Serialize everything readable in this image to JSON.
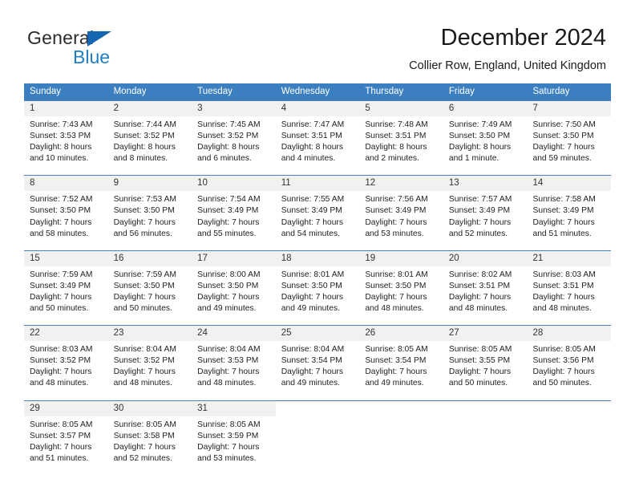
{
  "brand": {
    "name_part1": "General",
    "name_part2": "Blue",
    "accent_color": "#1f7ec4",
    "triangle_color": "#1565b0"
  },
  "header": {
    "title": "December 2024",
    "subtitle": "Collier Row, England, United Kingdom"
  },
  "calendar": {
    "header_bg": "#3c7fc1",
    "daynum_bg": "#f1f1f1",
    "weekdays": [
      "Sunday",
      "Monday",
      "Tuesday",
      "Wednesday",
      "Thursday",
      "Friday",
      "Saturday"
    ],
    "weeks": [
      [
        {
          "day": "1",
          "sunrise": "Sunrise: 7:43 AM",
          "sunset": "Sunset: 3:53 PM",
          "daylight": "Daylight: 8 hours and 10 minutes."
        },
        {
          "day": "2",
          "sunrise": "Sunrise: 7:44 AM",
          "sunset": "Sunset: 3:52 PM",
          "daylight": "Daylight: 8 hours and 8 minutes."
        },
        {
          "day": "3",
          "sunrise": "Sunrise: 7:45 AM",
          "sunset": "Sunset: 3:52 PM",
          "daylight": "Daylight: 8 hours and 6 minutes."
        },
        {
          "day": "4",
          "sunrise": "Sunrise: 7:47 AM",
          "sunset": "Sunset: 3:51 PM",
          "daylight": "Daylight: 8 hours and 4 minutes."
        },
        {
          "day": "5",
          "sunrise": "Sunrise: 7:48 AM",
          "sunset": "Sunset: 3:51 PM",
          "daylight": "Daylight: 8 hours and 2 minutes."
        },
        {
          "day": "6",
          "sunrise": "Sunrise: 7:49 AM",
          "sunset": "Sunset: 3:50 PM",
          "daylight": "Daylight: 8 hours and 1 minute."
        },
        {
          "day": "7",
          "sunrise": "Sunrise: 7:50 AM",
          "sunset": "Sunset: 3:50 PM",
          "daylight": "Daylight: 7 hours and 59 minutes."
        }
      ],
      [
        {
          "day": "8",
          "sunrise": "Sunrise: 7:52 AM",
          "sunset": "Sunset: 3:50 PM",
          "daylight": "Daylight: 7 hours and 58 minutes."
        },
        {
          "day": "9",
          "sunrise": "Sunrise: 7:53 AM",
          "sunset": "Sunset: 3:50 PM",
          "daylight": "Daylight: 7 hours and 56 minutes."
        },
        {
          "day": "10",
          "sunrise": "Sunrise: 7:54 AM",
          "sunset": "Sunset: 3:49 PM",
          "daylight": "Daylight: 7 hours and 55 minutes."
        },
        {
          "day": "11",
          "sunrise": "Sunrise: 7:55 AM",
          "sunset": "Sunset: 3:49 PM",
          "daylight": "Daylight: 7 hours and 54 minutes."
        },
        {
          "day": "12",
          "sunrise": "Sunrise: 7:56 AM",
          "sunset": "Sunset: 3:49 PM",
          "daylight": "Daylight: 7 hours and 53 minutes."
        },
        {
          "day": "13",
          "sunrise": "Sunrise: 7:57 AM",
          "sunset": "Sunset: 3:49 PM",
          "daylight": "Daylight: 7 hours and 52 minutes."
        },
        {
          "day": "14",
          "sunrise": "Sunrise: 7:58 AM",
          "sunset": "Sunset: 3:49 PM",
          "daylight": "Daylight: 7 hours and 51 minutes."
        }
      ],
      [
        {
          "day": "15",
          "sunrise": "Sunrise: 7:59 AM",
          "sunset": "Sunset: 3:49 PM",
          "daylight": "Daylight: 7 hours and 50 minutes."
        },
        {
          "day": "16",
          "sunrise": "Sunrise: 7:59 AM",
          "sunset": "Sunset: 3:50 PM",
          "daylight": "Daylight: 7 hours and 50 minutes."
        },
        {
          "day": "17",
          "sunrise": "Sunrise: 8:00 AM",
          "sunset": "Sunset: 3:50 PM",
          "daylight": "Daylight: 7 hours and 49 minutes."
        },
        {
          "day": "18",
          "sunrise": "Sunrise: 8:01 AM",
          "sunset": "Sunset: 3:50 PM",
          "daylight": "Daylight: 7 hours and 49 minutes."
        },
        {
          "day": "19",
          "sunrise": "Sunrise: 8:01 AM",
          "sunset": "Sunset: 3:50 PM",
          "daylight": "Daylight: 7 hours and 48 minutes."
        },
        {
          "day": "20",
          "sunrise": "Sunrise: 8:02 AM",
          "sunset": "Sunset: 3:51 PM",
          "daylight": "Daylight: 7 hours and 48 minutes."
        },
        {
          "day": "21",
          "sunrise": "Sunrise: 8:03 AM",
          "sunset": "Sunset: 3:51 PM",
          "daylight": "Daylight: 7 hours and 48 minutes."
        }
      ],
      [
        {
          "day": "22",
          "sunrise": "Sunrise: 8:03 AM",
          "sunset": "Sunset: 3:52 PM",
          "daylight": "Daylight: 7 hours and 48 minutes."
        },
        {
          "day": "23",
          "sunrise": "Sunrise: 8:04 AM",
          "sunset": "Sunset: 3:52 PM",
          "daylight": "Daylight: 7 hours and 48 minutes."
        },
        {
          "day": "24",
          "sunrise": "Sunrise: 8:04 AM",
          "sunset": "Sunset: 3:53 PM",
          "daylight": "Daylight: 7 hours and 48 minutes."
        },
        {
          "day": "25",
          "sunrise": "Sunrise: 8:04 AM",
          "sunset": "Sunset: 3:54 PM",
          "daylight": "Daylight: 7 hours and 49 minutes."
        },
        {
          "day": "26",
          "sunrise": "Sunrise: 8:05 AM",
          "sunset": "Sunset: 3:54 PM",
          "daylight": "Daylight: 7 hours and 49 minutes."
        },
        {
          "day": "27",
          "sunrise": "Sunrise: 8:05 AM",
          "sunset": "Sunset: 3:55 PM",
          "daylight": "Daylight: 7 hours and 50 minutes."
        },
        {
          "day": "28",
          "sunrise": "Sunrise: 8:05 AM",
          "sunset": "Sunset: 3:56 PM",
          "daylight": "Daylight: 7 hours and 50 minutes."
        }
      ],
      [
        {
          "day": "29",
          "sunrise": "Sunrise: 8:05 AM",
          "sunset": "Sunset: 3:57 PM",
          "daylight": "Daylight: 7 hours and 51 minutes."
        },
        {
          "day": "30",
          "sunrise": "Sunrise: 8:05 AM",
          "sunset": "Sunset: 3:58 PM",
          "daylight": "Daylight: 7 hours and 52 minutes."
        },
        {
          "day": "31",
          "sunrise": "Sunrise: 8:05 AM",
          "sunset": "Sunset: 3:59 PM",
          "daylight": "Daylight: 7 hours and 53 minutes."
        },
        {
          "day": "",
          "sunrise": "",
          "sunset": "",
          "daylight": ""
        },
        {
          "day": "",
          "sunrise": "",
          "sunset": "",
          "daylight": ""
        },
        {
          "day": "",
          "sunrise": "",
          "sunset": "",
          "daylight": ""
        },
        {
          "day": "",
          "sunrise": "",
          "sunset": "",
          "daylight": ""
        }
      ]
    ]
  }
}
